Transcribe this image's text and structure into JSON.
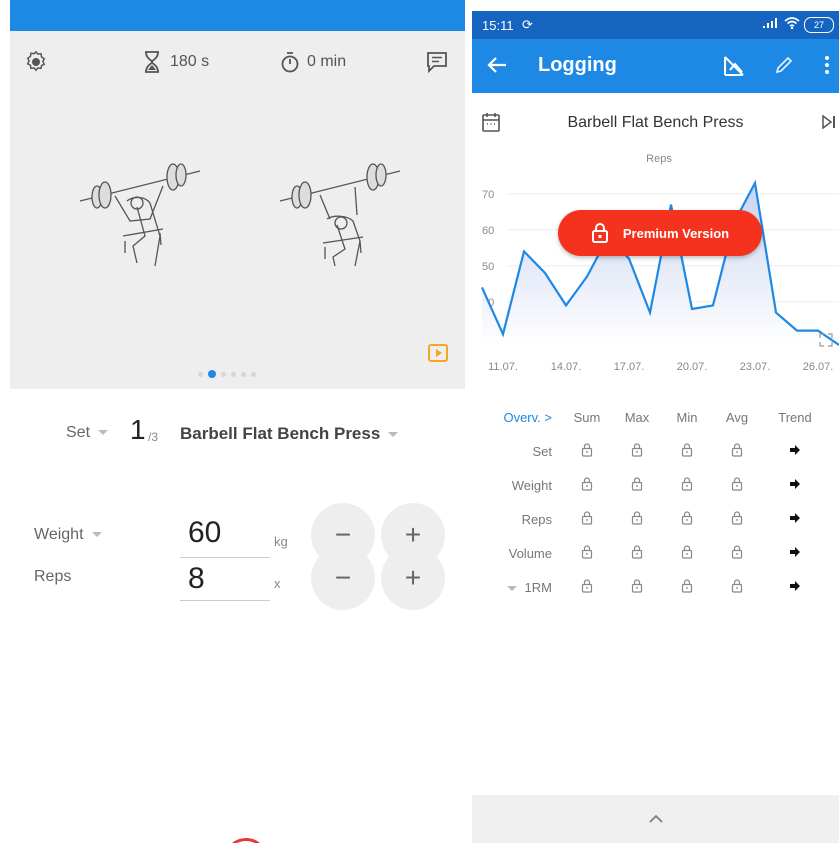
{
  "left": {
    "toolbar": {
      "timer_value": "180 s",
      "stopwatch_value": "0 min"
    },
    "set": {
      "label": "Set",
      "number": "1",
      "of": "/3",
      "exercise": "Barbell Flat Bench Press"
    },
    "weight": {
      "label": "Weight",
      "value": "60",
      "unit": "kg"
    },
    "reps": {
      "label": "Reps",
      "value": "8",
      "unit": "x"
    },
    "minus": "−",
    "plus": "+",
    "page_count": 6,
    "active_page": 1
  },
  "right": {
    "status": {
      "time": "15:11",
      "battery": "27"
    },
    "appbar": {
      "title": "Logging"
    },
    "exercise_name": "Barbell Flat Bench Press",
    "premium_label": "Premium Version",
    "chart_data": {
      "type": "area",
      "title": "Reps",
      "x": [
        "10.07.",
        "11.07.",
        "12.07.",
        "13.07.",
        "14.07.",
        "15.07.",
        "16.07.",
        "17.07.",
        "18.07.",
        "19.07.",
        "20.07.",
        "21.07.",
        "22.07.",
        "23.07.",
        "24.07.",
        "25.07.",
        "26.07.",
        "27.07."
      ],
      "values": [
        44,
        31,
        54,
        48,
        39,
        47,
        58,
        52,
        37,
        67,
        38,
        39,
        62,
        73,
        37,
        32,
        32,
        28
      ],
      "xticks": [
        "11.07.",
        "14.07.",
        "17.07.",
        "20.07.",
        "23.07.",
        "26.07."
      ],
      "yticks": [
        30,
        40,
        50,
        60,
        70
      ],
      "ylim": [
        28,
        78
      ],
      "colors": {
        "line": "#1e88e5",
        "fill_top": "#c9d3f0",
        "fill_bottom": "#ffffff"
      }
    },
    "stats": {
      "headers": [
        "Overv. >",
        "Sum",
        "Max",
        "Min",
        "Avg",
        "Trend"
      ],
      "rows": [
        "Set",
        "Weight",
        "Reps",
        "Volume",
        "1RM"
      ]
    }
  }
}
